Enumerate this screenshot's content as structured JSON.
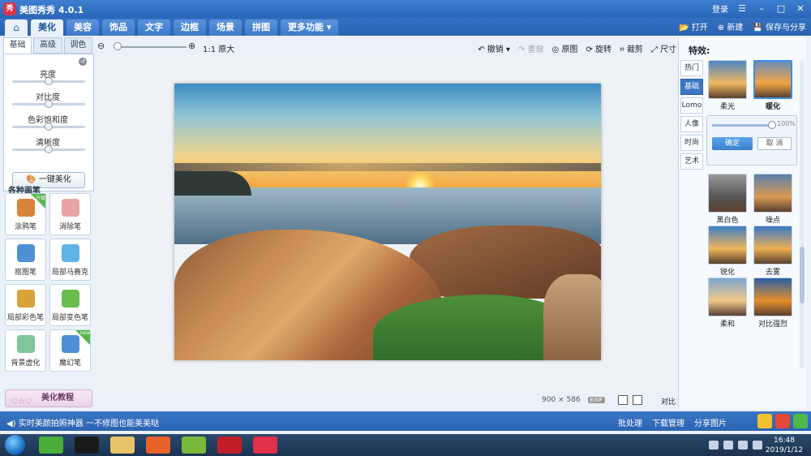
{
  "app": {
    "title": "美图秀秀 4.0.1",
    "login": "登录",
    "window_controls": [
      "☰",
      "–",
      "□",
      "✕"
    ]
  },
  "nav": {
    "home_icon": "home-icon",
    "tabs": [
      {
        "label": "美化",
        "active": true
      },
      {
        "label": "美容",
        "active": false
      },
      {
        "label": "饰品",
        "active": false
      },
      {
        "label": "文字",
        "active": false
      },
      {
        "label": "边框",
        "active": false
      },
      {
        "label": "场景",
        "active": false
      },
      {
        "label": "拼图",
        "active": false
      },
      {
        "label": "更多功能 ▾",
        "active": false
      }
    ],
    "open": "打开",
    "new": "新建",
    "save_share": "保存与分享"
  },
  "adjust": {
    "tabs": [
      {
        "label": "基础",
        "active": true
      },
      {
        "label": "高级",
        "active": false
      },
      {
        "label": "调色",
        "active": false
      }
    ],
    "sliders": [
      {
        "label": "亮度",
        "value": 0.5
      },
      {
        "label": "对比度",
        "value": 0.5
      },
      {
        "label": "色彩饱和度",
        "value": 0.5
      },
      {
        "label": "清晰度",
        "value": 0.5
      }
    ],
    "onekey_label": "一键美化"
  },
  "brushes": {
    "title": "各种画笔",
    "items": [
      {
        "label": "涂鸦笔",
        "badge": "升级",
        "color": "#d9823a"
      },
      {
        "label": "消除笔",
        "badge": "",
        "color": "#e9a3a3"
      },
      {
        "label": "抠图笔",
        "badge": "",
        "color": "#4f8fd6"
      },
      {
        "label": "局部马赛克",
        "badge": "",
        "color": "#5fb4e6"
      },
      {
        "label": "局部彩色笔",
        "badge": "",
        "color": "#d9a33a"
      },
      {
        "label": "局部变色笔",
        "badge": "",
        "color": "#6bbd4f"
      },
      {
        "label": "背景虚化",
        "badge": "",
        "color": "#7fc79a"
      },
      {
        "label": "魔幻笔",
        "badge": "new",
        "color": "#4f8fd6"
      }
    ]
  },
  "tutorial_label": "美化教程",
  "toolbar": {
    "zoom_label": "1:1 原大",
    "zoom_level": 0.0,
    "undo": "撤销",
    "redo": "重做",
    "original": "原图",
    "rotate": "旋转",
    "crop": "裁剪",
    "resize": "尺寸"
  },
  "canvas": {
    "image_width": "900",
    "times": "×",
    "image_height": "586",
    "exif": "EXIF",
    "compare_label": "对比"
  },
  "effects": {
    "title": "特效:",
    "categories": [
      {
        "label": "热门",
        "active": false
      },
      {
        "label": "基础",
        "active": true
      },
      {
        "label": "Lomo",
        "active": false
      },
      {
        "label": "人像",
        "active": false
      },
      {
        "label": "时尚",
        "active": false
      },
      {
        "label": "艺术",
        "active": false
      }
    ],
    "items": [
      {
        "label": "柔光",
        "selected": false,
        "colors": [
          "#4d87c4",
          "#f0b862"
        ]
      },
      {
        "label": "暖化",
        "selected": true,
        "colors": [
          "#6e8fb8",
          "#f2a545"
        ]
      },
      {
        "label": "黑白色",
        "selected": false,
        "colors": [
          "#9a9a9a",
          "#555555"
        ]
      },
      {
        "label": "噪点",
        "selected": false,
        "colors": [
          "#5a7fae",
          "#d99a52"
        ]
      },
      {
        "label": "锐化",
        "selected": false,
        "colors": [
          "#3f7fc4",
          "#f0b65c"
        ]
      },
      {
        "label": "去雾",
        "selected": false,
        "colors": [
          "#3a79c6",
          "#eeb052"
        ]
      },
      {
        "label": "柔和",
        "selected": false,
        "colors": [
          "#7ea6cf",
          "#f0c88a"
        ]
      },
      {
        "label": "对比强烈",
        "selected": false,
        "colors": [
          "#2a5fa6",
          "#e68f2a"
        ]
      }
    ],
    "intensity": {
      "value": 1.0,
      "label": "100%"
    },
    "confirm": "确定",
    "cancel": "取 消"
  },
  "status": {
    "tip": "◀) 实时美颜拍照神器 一不修图也能美美哒",
    "batch": "批处理",
    "download": "下载管理",
    "share": "分享图片"
  },
  "taskbar": {
    "apps": [
      {
        "name": "360-browser-icon",
        "color": "#4cae3a"
      },
      {
        "name": "qq-icon",
        "color": "#1b1b1b"
      },
      {
        "name": "file-explorer-icon",
        "color": "#e8c46a"
      },
      {
        "name": "firefox-icon",
        "color": "#e8622a"
      },
      {
        "name": "media-player-icon",
        "color": "#7ab83a"
      },
      {
        "name": "record-icon",
        "color": "#c01f2a"
      },
      {
        "name": "meitu-icon",
        "color": "#e0304a"
      }
    ],
    "time": "16:48",
    "date": "2019/1/12"
  }
}
